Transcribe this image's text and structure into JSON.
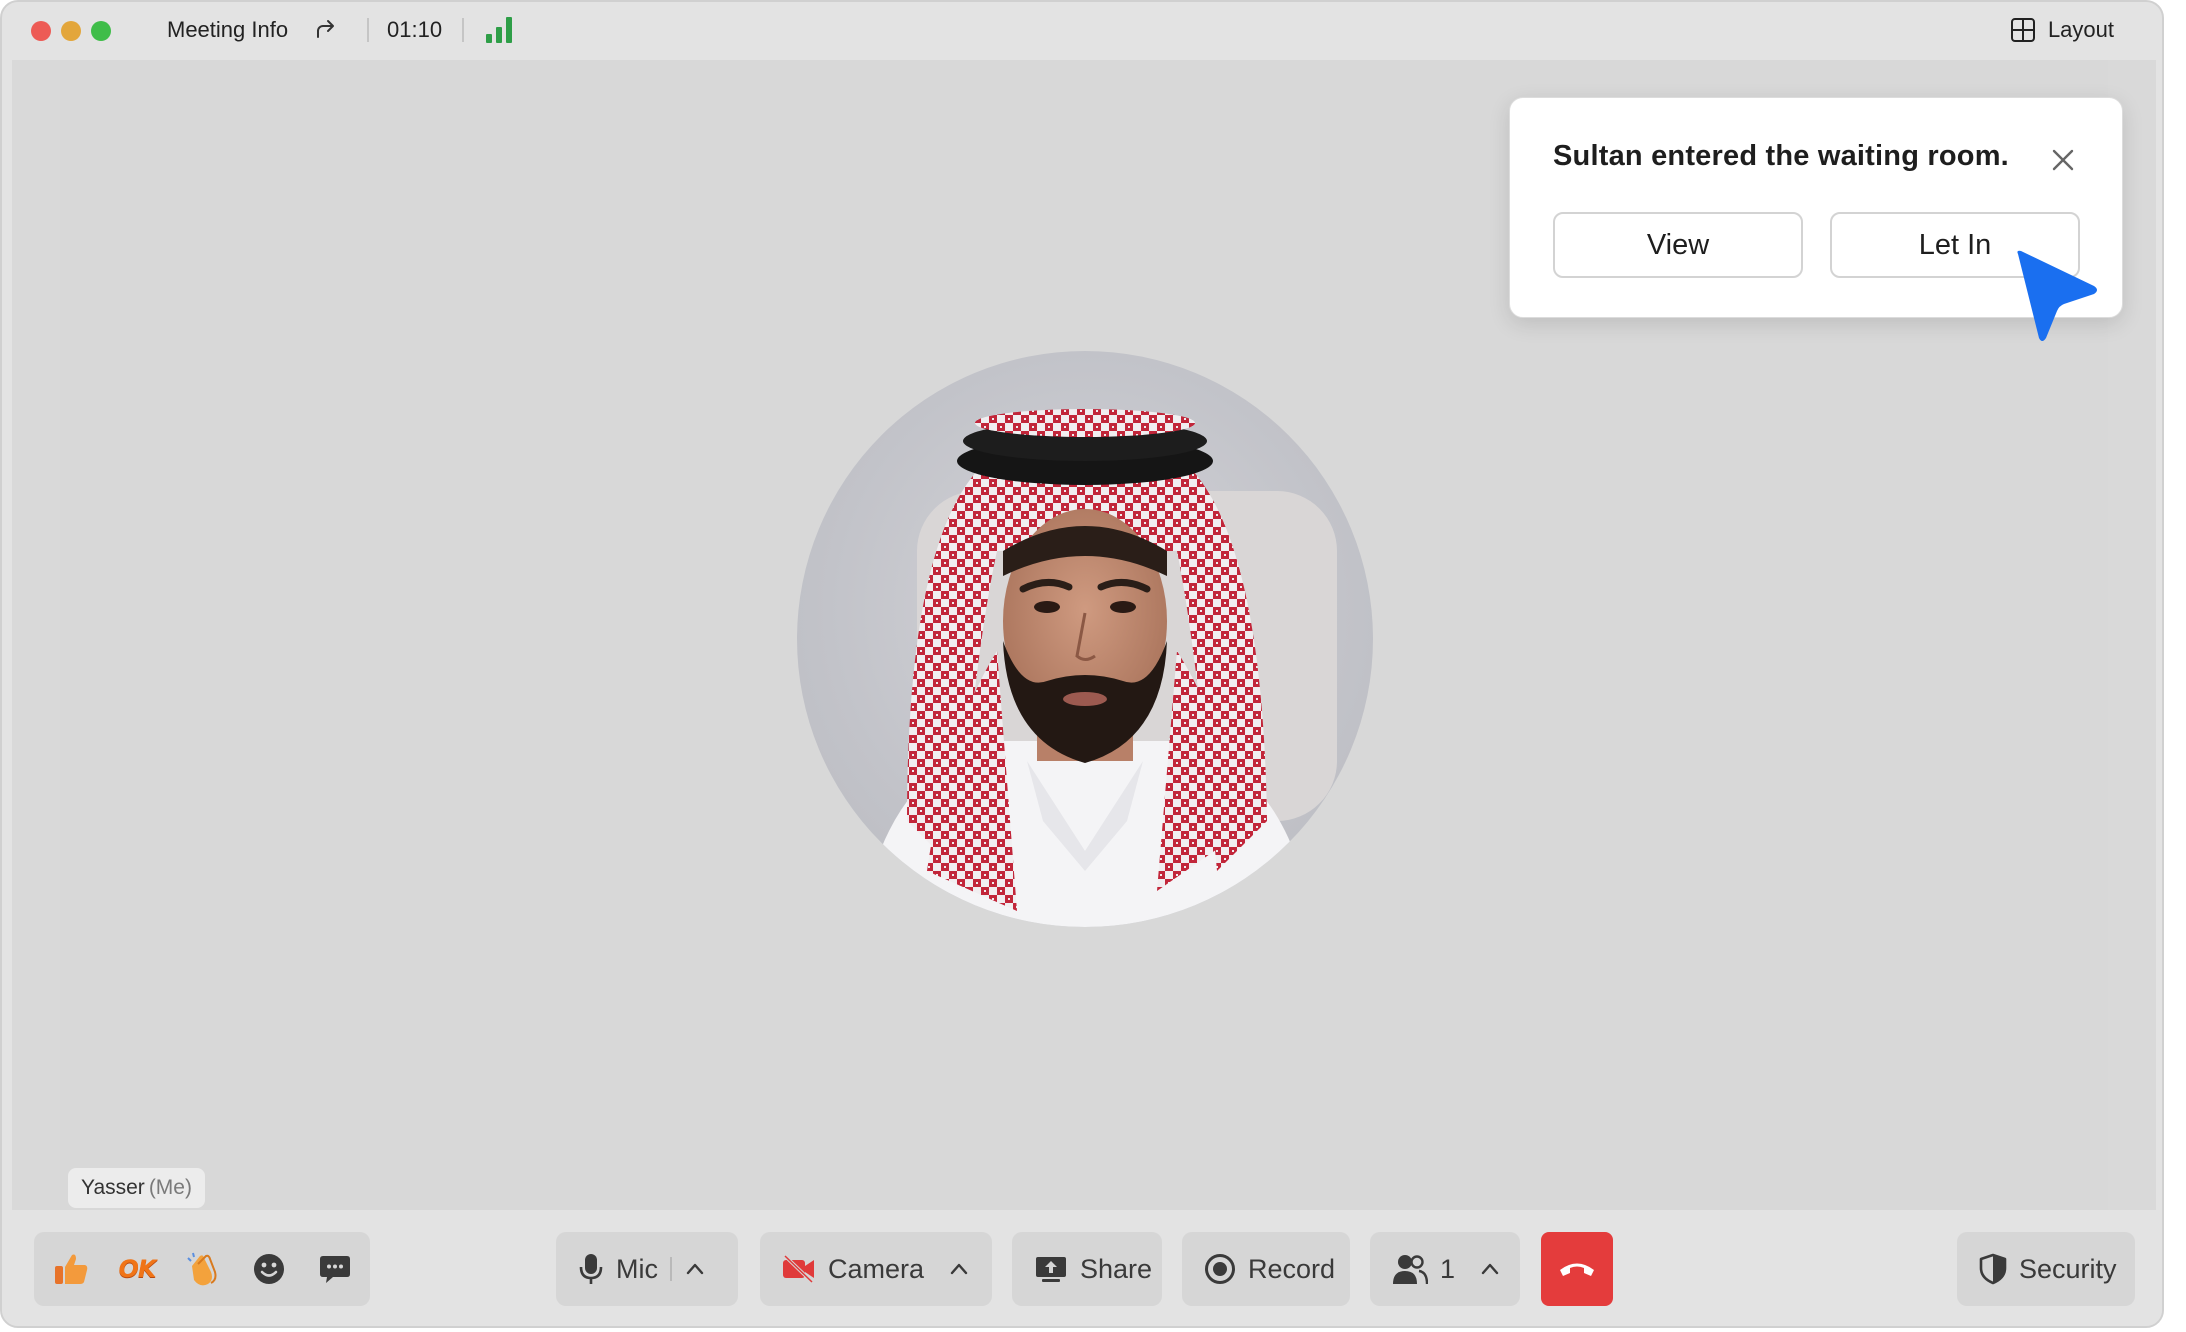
{
  "titlebar": {
    "meeting_info_label": "Meeting Info",
    "timer": "01:10",
    "layout_label": "Layout"
  },
  "notification": {
    "message": "Sultan entered the waiting room.",
    "view_label": "View",
    "let_in_label": "Let In"
  },
  "participant": {
    "name": "Yasser",
    "self_suffix": "(Me)"
  },
  "toolbar": {
    "reactions": [
      "thumbs-up-icon",
      "ok-emoji",
      "clap-icon",
      "smiley-icon",
      "chat-bubble-icon"
    ],
    "ok_label": "OK",
    "mic_label": "Mic",
    "camera_label": "Camera",
    "share_label": "Share",
    "record_label": "Record",
    "participants_count": "1",
    "security_label": "Security"
  },
  "colors": {
    "hangup": "#e43c3c",
    "signal": "#2e9e47",
    "cursor": "#1a6ff0",
    "camera_off": "#e03a3a",
    "close_dot": "#ed5b55",
    "min_dot": "#e3a63b",
    "max_dot": "#3fbd49"
  }
}
